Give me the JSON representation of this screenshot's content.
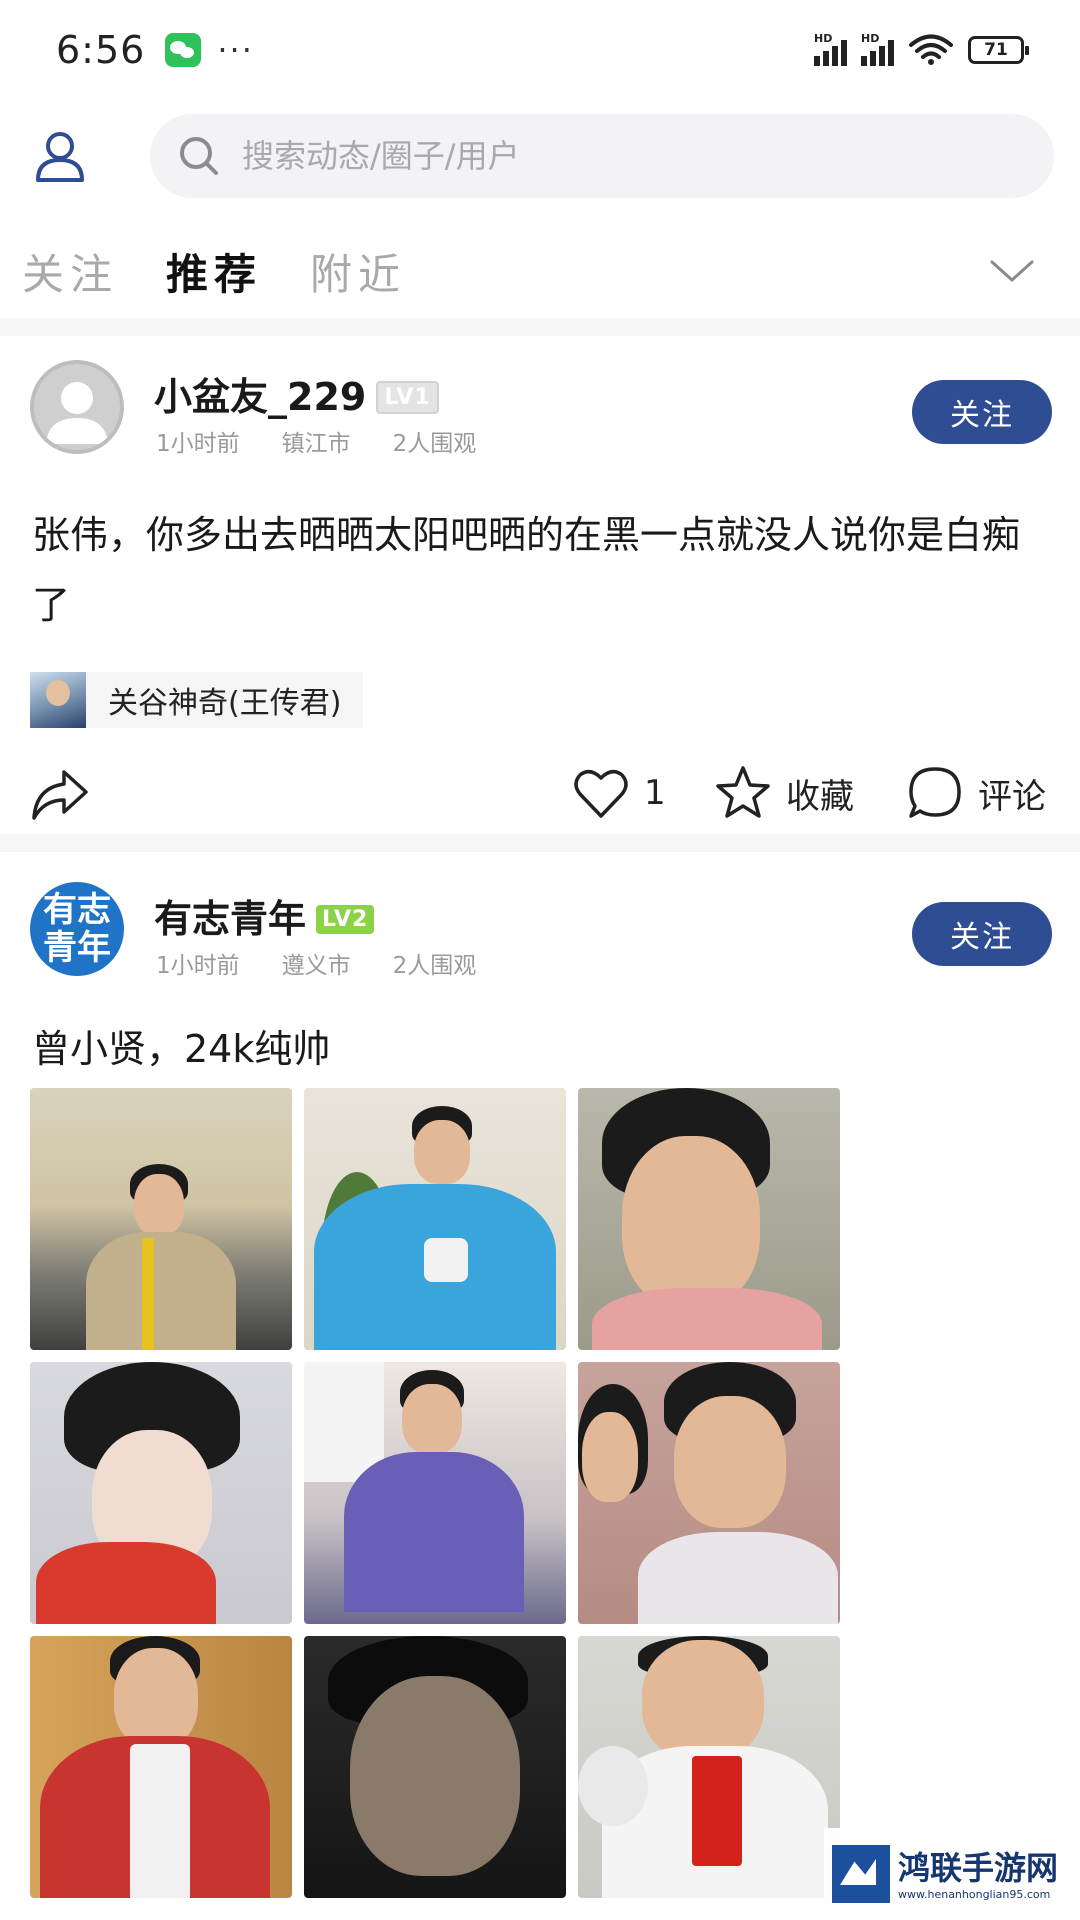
{
  "status_bar": {
    "time": "6:56",
    "more": "···",
    "signal1_label": "HD",
    "signal2_label": "HD",
    "battery": "71"
  },
  "search": {
    "placeholder": "搜索动态/圈子/用户"
  },
  "tabs": [
    {
      "label": "关注",
      "active": false
    },
    {
      "label": "推荐",
      "active": true
    },
    {
      "label": "附近",
      "active": false
    }
  ],
  "posts": [
    {
      "username": "小盆友_229",
      "level": "LV1",
      "time": "1小时前",
      "city": "镇江市",
      "views": "2人围观",
      "follow_label": "关注",
      "text": "张伟，你多出去晒晒太阳吧晒的在黑一点就没人说你是白痴了",
      "circle": "关谷神奇(王传君)",
      "likes": "1",
      "favorite_label": "收藏",
      "comment_label": "评论"
    },
    {
      "username": "有志青年",
      "level": "LV2",
      "avatar_text_line1": "有志",
      "avatar_text_line2": "青年",
      "time": "1小时前",
      "city": "遵义市",
      "views": "2人围观",
      "follow_label": "关注",
      "text": "曾小贤，24k纯帅",
      "image_count": 9
    }
  ],
  "watermark": {
    "title": "鸿联手游网",
    "url": "www.henanhonglian95.com"
  },
  "colors": {
    "follow_button": "#2f4d93",
    "lv2_badge": "#8bd14a",
    "tab_inactive": "#a9a9a9",
    "meta_text": "#9a9a9a"
  }
}
